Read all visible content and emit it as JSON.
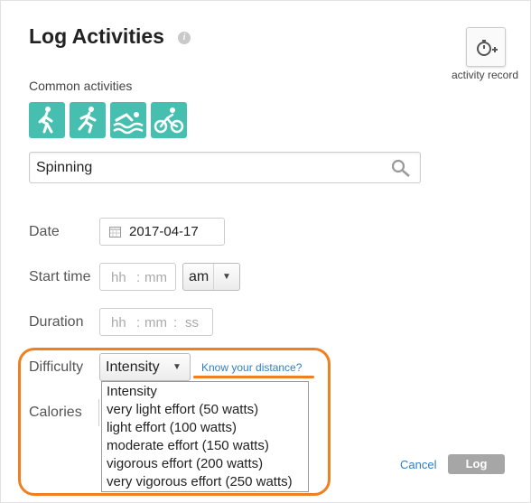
{
  "dialog": {
    "title": "Log Activities",
    "info_icon": "info-icon",
    "activity_record_label": "activity record"
  },
  "common": {
    "label": "Common activities",
    "activities": [
      "walking-icon",
      "running-icon",
      "swimming-icon",
      "cycling-icon"
    ]
  },
  "search": {
    "value": "Spinning",
    "icon": "search-icon"
  },
  "form": {
    "date_label": "Date",
    "date_value": "2017-04-17",
    "start_time_label": "Start time",
    "start_hh_placeholder": "hh",
    "start_mm_placeholder": "mm",
    "ampm_value": "am",
    "duration_label": "Duration",
    "dur_hh_placeholder": "hh",
    "dur_mm_placeholder": "mm",
    "dur_ss_placeholder": "ss",
    "difficulty_label": "Difficulty",
    "difficulty_value": "Intensity",
    "distance_link": "Know your distance?",
    "calories_label": "Calories"
  },
  "difficulty_options": [
    "Intensity",
    "very light effort (50 watts)",
    "light effort (100 watts)",
    "moderate effort (150 watts)",
    "vigorous effort (200 watts)",
    "very vigorous effort (250 watts)"
  ],
  "actions": {
    "cancel_label": "Cancel",
    "log_label": "Log"
  },
  "colors": {
    "accent_teal": "#46bfb0",
    "highlight_orange": "#f07f1f",
    "link_blue": "#2e7fc6",
    "log_button_gray": "#a6a6a6"
  }
}
